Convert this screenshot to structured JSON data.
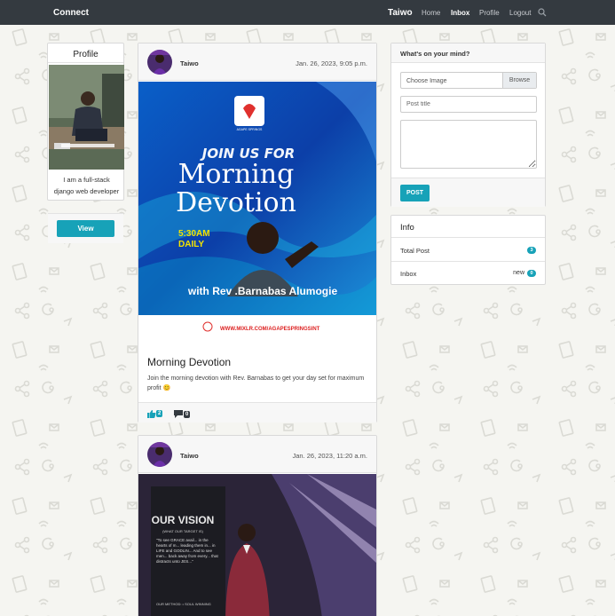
{
  "navbar": {
    "brand": "Connect",
    "user": "Taiwo",
    "links": [
      "Home",
      "Inbox",
      "Profile",
      "Logout"
    ],
    "active_link": "Inbox"
  },
  "profile": {
    "header": "Profile",
    "bio": "I am a full-stack django web developer",
    "view_label": "View"
  },
  "posts": [
    {
      "author": "Taiwo",
      "date": "Jan. 26, 2023, 9:05 p.m.",
      "title": "Morning Devotion",
      "body": "Join the morning devotion with Rev. Barnabas to get your day set for maximum profit 😊",
      "likes": "2",
      "comments": "0",
      "image": {
        "line1": "JOIN US FOR",
        "line2": "Morning",
        "line3": "Devotion",
        "time": "5:30AM",
        "freq": "DAILY",
        "host": "with Rev .Barnabas Alumogie",
        "url": "WWW.MIXLR.COM/AGAPESPRINGSINT",
        "logo_text": "AGAPE SPRINGS"
      }
    },
    {
      "author": "Taiwo",
      "date": "Jan. 26, 2023, 11:20 a.m.",
      "image": {
        "banner_title": "OUR VISION",
        "banner_sub": "(WHAT OUR TARGET IS)",
        "banner_text": "\"To see GRACE avail... in the hearts of m... leading them in... in LIFE and GODLIN... And to see men... back away from every... that distracts unto JES...\"",
        "banner_method": "OUR METHOD: • SOUL WINNING"
      }
    }
  ],
  "composer": {
    "header": "What's on your mind?",
    "file_placeholder": "Choose Image",
    "browse_label": "Browse",
    "title_placeholder": "Post title",
    "submit_label": "POST"
  },
  "info": {
    "header": "Info",
    "rows": [
      {
        "label": "Total Post",
        "extra": "",
        "badge": "3"
      },
      {
        "label": "Inbox",
        "extra": "new",
        "badge": "0"
      }
    ]
  },
  "colors": {
    "navbar": "#343a40",
    "accent": "#17a2b8",
    "page_bg": "#f5f5f1"
  }
}
